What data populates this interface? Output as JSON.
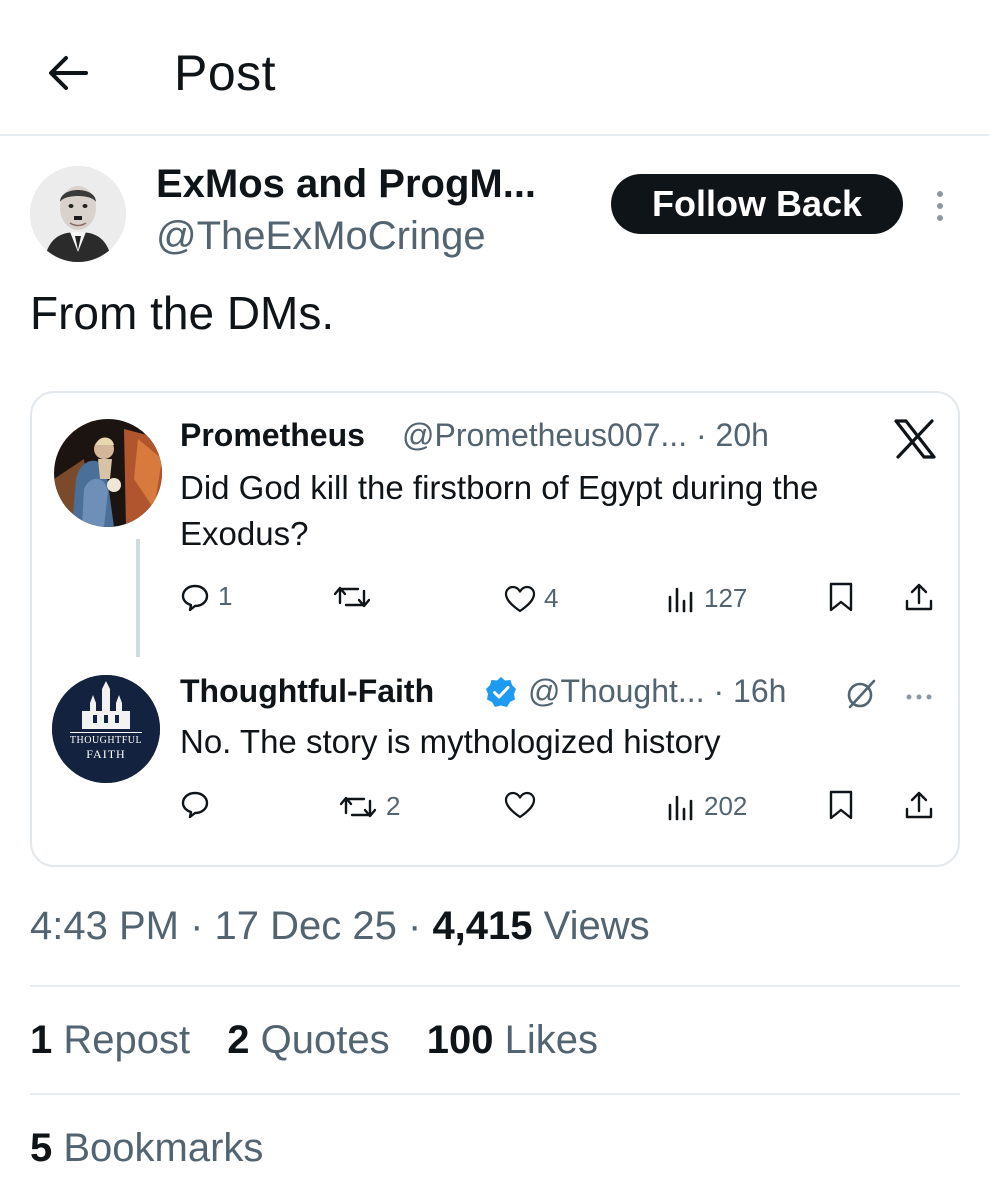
{
  "header": {
    "title": "Post",
    "back_icon": "arrow-left-icon"
  },
  "author": {
    "display_name": "ExMos and ProgM...",
    "handle": "@TheExMoCringe",
    "follow_label": "Follow Back",
    "more_icon": "more-vertical-icon"
  },
  "post": {
    "text": "From the DMs."
  },
  "quote": {
    "logo": "x-logo-icon",
    "tweet1": {
      "name": "Prometheus",
      "handle_time": "@Prometheus007... · 20h",
      "text": "Did God kill the firstborn of Egypt during the Exodus?",
      "replies": "1",
      "reposts": "",
      "likes": "4",
      "views": "127"
    },
    "tweet2": {
      "name": "Thoughtful-Faith",
      "handle_time": "@Thought... · 16h",
      "text": "No. The story is mythologized history",
      "avatar_text_line1": "THOUGHTFUL",
      "avatar_text_line2": "FAITH",
      "replies": "",
      "reposts": "2",
      "likes": "",
      "views": "202"
    }
  },
  "meta": {
    "time": "4:43 PM",
    "date": "17 Dec 25",
    "views_count": "4,415",
    "views_label": "Views"
  },
  "stats": {
    "reposts_count": "1",
    "reposts_label": "Repost",
    "quotes_count": "2",
    "quotes_label": "Quotes",
    "likes_count": "100",
    "likes_label": "Likes",
    "bookmarks_count": "5",
    "bookmarks_label": "Bookmarks"
  },
  "colors": {
    "text": "#0f1419",
    "secondary": "#536471",
    "verified": "#1d9bf0",
    "divider": "#e6ecf0"
  }
}
